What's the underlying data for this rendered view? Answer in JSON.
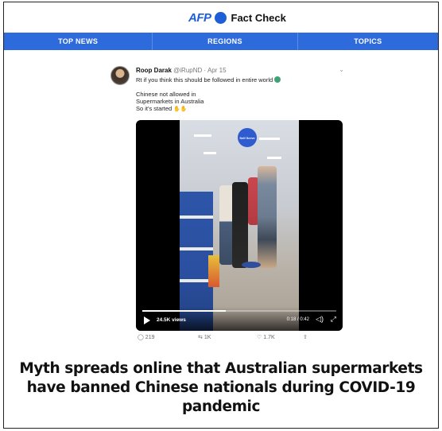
{
  "brand": {
    "logo_text": "AFP",
    "title": "Fact Check",
    "brand_color": "#1f5fd6"
  },
  "nav": {
    "items": [
      "TOP NEWS",
      "REGIONS",
      "TOPICS"
    ],
    "bar_color": "#2d6bdc"
  },
  "tweet": {
    "author_name": "Roop Darak",
    "author_handle": "@iRupND",
    "separator": "·",
    "date": "Apr 15",
    "text_line1": "Rt if you think this should be followed in entire world",
    "text_lines": [
      "Chinese not allowed in",
      "Supermarkets in Australia",
      "So it's started"
    ],
    "video": {
      "views": "24.5K views",
      "time": "0:18 / 0:42",
      "progress": 0.43,
      "sign_text": "Self Serve"
    },
    "actions": {
      "replies": "219",
      "retweets": "1K",
      "likes": "1.7K"
    }
  },
  "headline": {
    "lines": [
      "Myth spreads online that Australian supermarkets",
      "have banned Chinese nationals during COVID-19",
      "pandemic"
    ]
  }
}
